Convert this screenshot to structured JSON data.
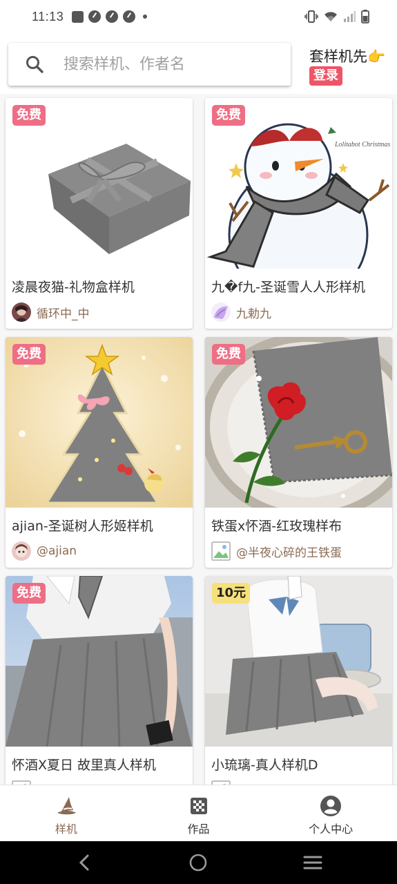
{
  "status_bar": {
    "time": "11:13"
  },
  "header": {
    "search_placeholder": "搜索样机、作者名",
    "brand": "套样机先👉",
    "login_label": "登录"
  },
  "cards": [
    {
      "badge": "免费",
      "title": "凌晨夜猫-礼物盒样机",
      "author": "循环中_中",
      "image": "gift-box"
    },
    {
      "badge": "免费",
      "title": "九�f九-圣诞雪人人形样机",
      "author": "九勅九",
      "image": "snowman"
    },
    {
      "badge": "免费",
      "title": "ajian-圣诞树人形姬样机",
      "author": "@ajian",
      "image": "christmas-tree"
    },
    {
      "badge": "免费",
      "title": "铁蛋x怀酒-红玫瑰样布",
      "author": "@半夜心碎的王铁蛋",
      "image": "rose-fabric"
    },
    {
      "badge": "免费",
      "title": "怀酒X夏日 故里真人样机",
      "author": "",
      "image": "uniform-girl"
    },
    {
      "badge": "10元",
      "title": "小琉璃-真人样机D",
      "author": "",
      "image": "sitting-girl"
    }
  ],
  "bottom_nav": [
    {
      "label": "样机",
      "icon": "wizard-hat-icon",
      "active": true
    },
    {
      "label": "作品",
      "icon": "checkerboard-icon",
      "active": false
    },
    {
      "label": "个人中心",
      "icon": "user-circle-icon",
      "active": false
    }
  ],
  "colors": {
    "badge_free": "#ee6e85",
    "badge_paid": "#f6e07a",
    "accent": "#8b6a52",
    "login": "#ee5566"
  }
}
